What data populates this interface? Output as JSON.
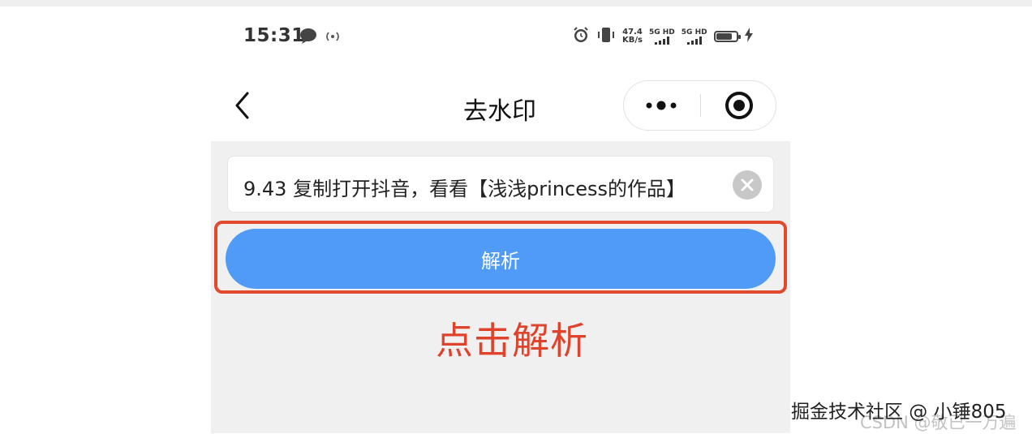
{
  "status_bar": {
    "time": "15:31",
    "net_speed_value": "47.4",
    "net_speed_unit": "KB/s",
    "sim1_label": "5G HD",
    "sim2_label": "5G HD",
    "battery_level": 0.8
  },
  "nav": {
    "title": "去水印"
  },
  "input": {
    "value": "9.43 复制打开抖音，看看【浅浅princess的作品】"
  },
  "parse_button": {
    "label": "解析"
  },
  "annotation": {
    "text": "点击解析"
  },
  "watermark": {
    "text": "掘金技术社区 @ 小锤805",
    "faint_text": "CSDN @敬已一万遍"
  },
  "colors": {
    "button_blue": "#4f9bf6",
    "annotation_red": "#e0432b",
    "content_bg": "#f0f0f0"
  }
}
